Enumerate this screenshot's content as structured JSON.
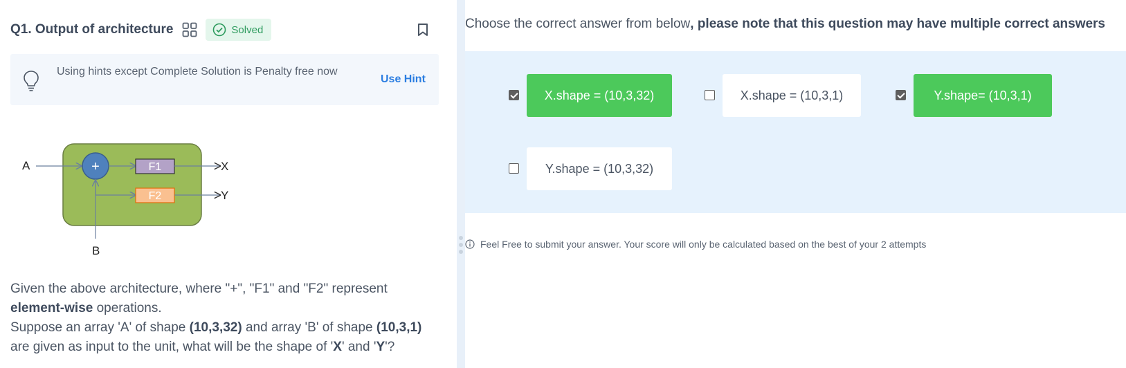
{
  "question": {
    "title": "Q1. Output of architecture",
    "status_label": "Solved",
    "hint_text": "Using hints except Complete Solution is Penalty free now",
    "hint_button": "Use Hint",
    "text_line1": "Given the above architecture, where \"+\", \"F1\" and \"F2\" represent",
    "text_bold1": "element-wise",
    "text_line2_rest": " operations.",
    "text_line3_a": "Suppose an array 'A' of shape ",
    "text_bold_a_shape": "(10,3,32)",
    "text_line3_b": " and array 'B' of shape ",
    "text_bold_b_shape": "(10,3,1)",
    "text_line4_a": "are given as input to the unit, what will be the shape of '",
    "text_bold_x": "X",
    "text_line4_b": "' and '",
    "text_bold_y": "Y",
    "text_line4_c": "'?"
  },
  "diagram": {
    "input_a": "A",
    "input_b": "B",
    "op_plus": "+",
    "f1": "F1",
    "f2": "F2",
    "output_x": "X",
    "output_y": "Y",
    "colors": {
      "block": "#9bbb59",
      "block_border": "#6b7f44",
      "plus": "#4f81bd",
      "f1": "#b3a2c7",
      "f2": "#fac090"
    }
  },
  "answers": {
    "instruction_plain": "Choose the correct answer from below",
    "instruction_bold": ", please note that this question may have multiple correct answers",
    "options": [
      {
        "label": "X.shape = (10,3,32)",
        "checked": true
      },
      {
        "label": "X.shape = (10,3,1)",
        "checked": false
      },
      {
        "label": "Y.shape= (10,3,1)",
        "checked": true
      },
      {
        "label": "Y.shape = (10,3,32)",
        "checked": false
      }
    ],
    "footnote": "Feel Free to submit your answer. Your score will only be calculated based on the best of your 2 attempts"
  },
  "colors": {
    "selected": "#4cc95b",
    "accent": "#2a7de1",
    "solved": "#2e9b5e"
  }
}
